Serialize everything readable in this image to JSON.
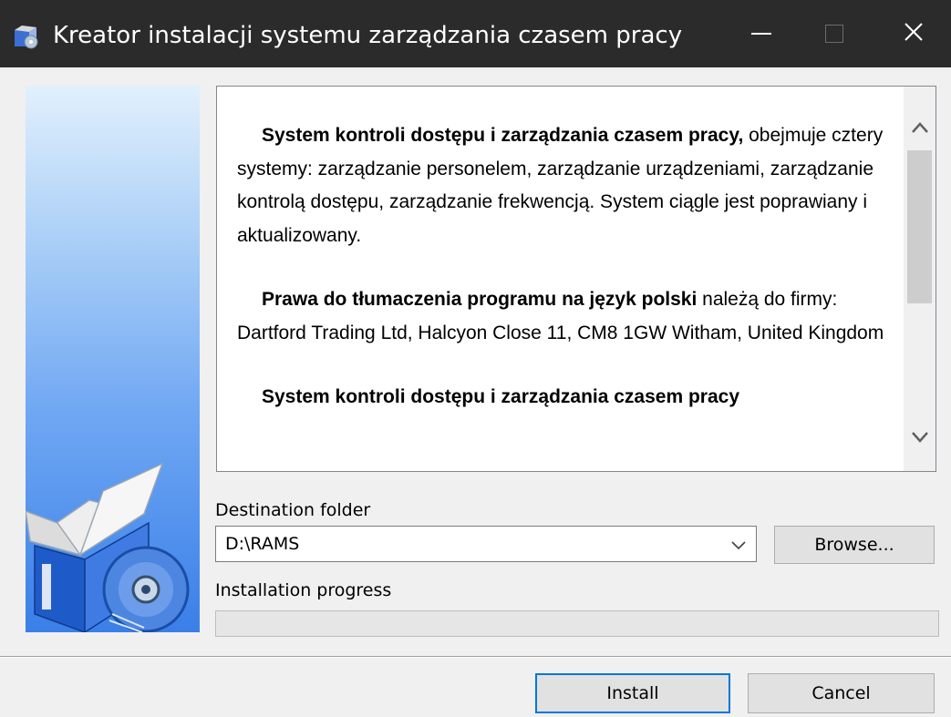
{
  "window": {
    "title": "Kreator instalacji systemu zarządzania czasem pracy",
    "icon": "installer-app-icon",
    "controls": [
      "minimize-icon",
      "maximize-icon",
      "close-icon"
    ]
  },
  "license_text": {
    "p1_bold": "System kontroli dostępu i zarządzania czasem pracy,",
    "p1_rest": " obejmuje cztery systemy: zarządzanie personelem, zarządzanie urządzeniami, zarządzanie kontrolą dostępu, zarządzanie frekwencją. System ciągle jest poprawiany i aktualizowany.",
    "p2_bold": "Prawa do tłumaczenia programu na język polski",
    "p2_rest": " należą do firmy: Dartford Trading Ltd, Halcyon Close 11, CM8 1GW Witham, United Kingdom",
    "p3_bold": "System kontroli dostępu i zarządzania czasem pracy"
  },
  "destination": {
    "label": "Destination folder",
    "value": "D:\\RAMS",
    "browse_label": "Browse..."
  },
  "progress": {
    "label": "Installation progress",
    "fraction": 0
  },
  "footer": {
    "install_label": "Install",
    "cancel_label": "Cancel"
  },
  "colors": {
    "titlebar": "#2b2b2b",
    "accent": "#0078d7"
  }
}
